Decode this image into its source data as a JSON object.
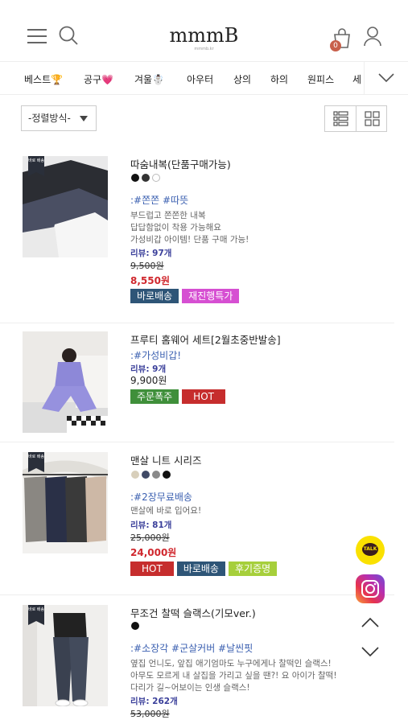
{
  "header": {
    "logo": "mmmB",
    "logo_sub": "mmmb.kr",
    "cart_count": "0"
  },
  "nav": {
    "categories": [
      "베스트🏆",
      "공구💗",
      "겨울☃️",
      "아우터",
      "상의",
      "하의",
      "원피스",
      "세"
    ]
  },
  "sort": {
    "label": "-정렬방식-"
  },
  "products": [
    {
      "name": "따숨내복(단품구매가능)",
      "colors": [
        "#111111",
        "#333333",
        "#ffffff"
      ],
      "ribbon": "바로 배송",
      "tags": ":#쫀쫀 #따뜻",
      "desc": [
        "부드럽고 쫀쫀한 내복",
        "답답함없이 착용 가능해요",
        "가성비갑 아이템! 단품 구매 가능!"
      ],
      "review": "리뷰: 97개",
      "old_price": "9,500원",
      "price": "8,550원",
      "badges": [
        {
          "label": "바로배송",
          "color": "#2e5577"
        },
        {
          "label": "재진행특가",
          "color": "#d64fd2"
        }
      ]
    },
    {
      "name": "프루티 홈웨어 세트[2월초중반발송]",
      "tags": ":#가성비갑!",
      "review": "리뷰: 9개",
      "price": "9,900원",
      "badges": [
        {
          "label": "주문폭주",
          "color": "#3f8f3a"
        },
        {
          "label": "HOT",
          "color": "#c62d2d"
        }
      ]
    },
    {
      "name": "맨살 니트 시리즈",
      "colors": [
        "#d8cfbb",
        "#404a66",
        "#8a8a8a",
        "#111111"
      ],
      "ribbon": "바로 배송",
      "tags": ":#2장무료배송",
      "desc": [
        "맨살에 바로 입어요!"
      ],
      "review": "리뷰: 81개",
      "old_price": "25,000원",
      "price": "24,000원",
      "badges": [
        {
          "label": "HOT",
          "color": "#c62d2d"
        },
        {
          "label": "바로배송",
          "color": "#2e5577"
        },
        {
          "label": "후기증명",
          "color": "#a6cf3b"
        }
      ]
    },
    {
      "name": "무조건 찰떡 슬랙스(기모ver.)",
      "colors": [
        "#111111"
      ],
      "ribbon": "바로 배송",
      "tags": ":#소장각 #군살커버 #날씬핏",
      "desc": [
        "옆집 언니도, 앞집 애기엄마도 누구에게나 찰떡인 슬랙스!",
        "아무도 모르게 내 살집을 가리고 싶을 땐?! 요 아이가 찰떡!",
        "다리가 길~어보이는 인생 슬랙스!"
      ],
      "review": "리뷰: 262개",
      "old_price": "53,000원"
    }
  ],
  "floating": {
    "talk_label": "TALK"
  }
}
